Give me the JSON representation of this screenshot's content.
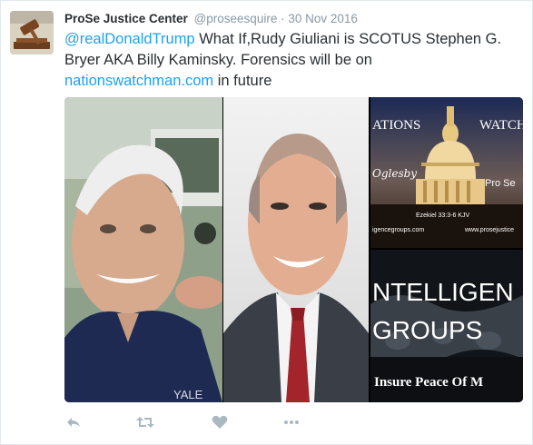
{
  "tweet": {
    "author_name": "ProSe Justice Center",
    "author_handle": "@proseesquire",
    "separator": "·",
    "timestamp": "30 Nov 2016",
    "text": {
      "mention": "@realDonaldTrump",
      "body_1": " What If,Rudy Giuliani is SCOTUS Stephen G. Bryer AKA Billy Kaminsky. Forensics will be on ",
      "link": "nationswatchman.com",
      "body_2": " in future"
    }
  },
  "media": {
    "top_right": {
      "title_left": "ATIONS",
      "title_right": "WATCH",
      "script_left": "Oglesby",
      "script_right": "Pro Se",
      "verse": "Ezekiel 33:3-6 KJV",
      "url_left": "igencegroups.com",
      "url_right": "www.prosejustice"
    },
    "bottom_right": {
      "line_1": "NTELLIGEN",
      "line_2": "GROUPS",
      "tagline": "Insure Peace Of M"
    },
    "shirt_text": "YALE"
  },
  "actions": {
    "reply": "reply-icon",
    "retweet": "retweet-icon",
    "like": "heart-icon",
    "more": "more-icon"
  },
  "colors": {
    "link": "#1da1f2",
    "muted": "#8899a6",
    "text": "#292f33"
  }
}
